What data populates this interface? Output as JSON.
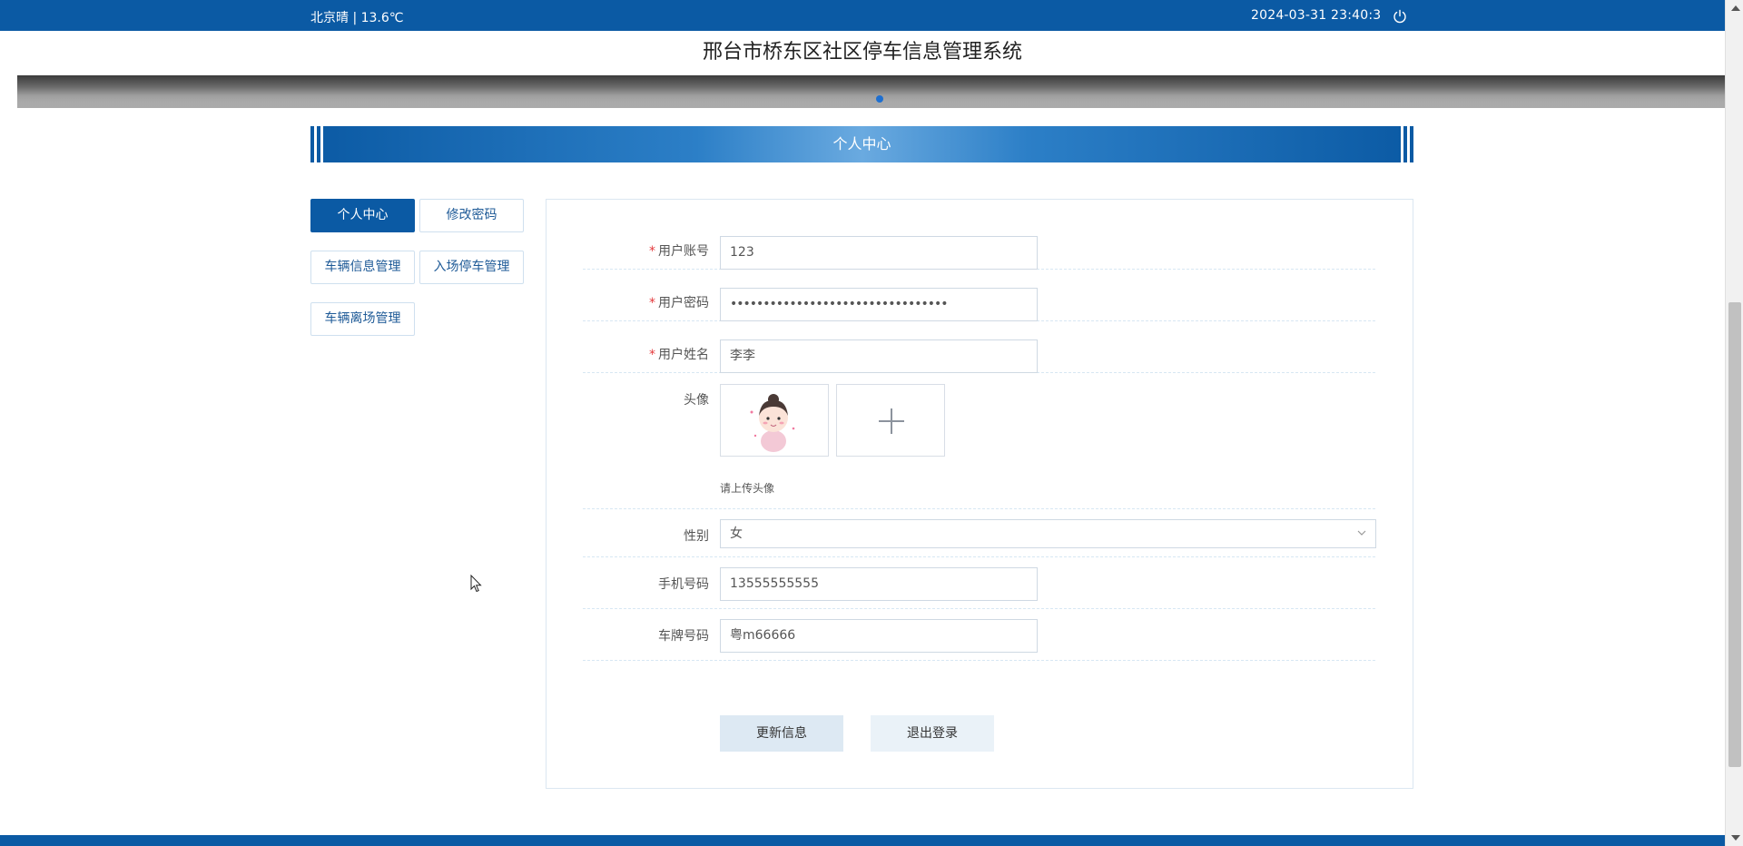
{
  "topbar": {
    "weather": "北京晴 | 13.6℃",
    "datetime": "2024-03-31   23:40:3"
  },
  "header": {
    "site_title": "邢台市桥东区社区停车信息管理系统"
  },
  "section": {
    "title": "个人中心"
  },
  "sidebar": {
    "items": [
      {
        "label": "个人中心",
        "active": true
      },
      {
        "label": "修改密码",
        "active": false
      },
      {
        "label": "车辆信息管理",
        "active": false
      },
      {
        "label": "入场停车管理",
        "active": false
      },
      {
        "label": "车辆离场管理",
        "active": false
      }
    ]
  },
  "form": {
    "account": {
      "label": "用户账号",
      "value": "123"
    },
    "password": {
      "label": "用户密码",
      "value": "•••••••••••••••••••••••••••••••••"
    },
    "name": {
      "label": "用户姓名",
      "value": "李李"
    },
    "avatar": {
      "label": "头像",
      "hint": "请上传头像"
    },
    "gender": {
      "label": "性别",
      "value": "女"
    },
    "phone": {
      "label": "手机号码",
      "value": "13555555555"
    },
    "plate": {
      "label": "车牌号码",
      "value": "粤m66666"
    }
  },
  "actions": {
    "update_label": "更新信息",
    "logout_label": "退出登录"
  },
  "colors": {
    "primary": "#0b5aa4",
    "required": "#e4393c"
  }
}
